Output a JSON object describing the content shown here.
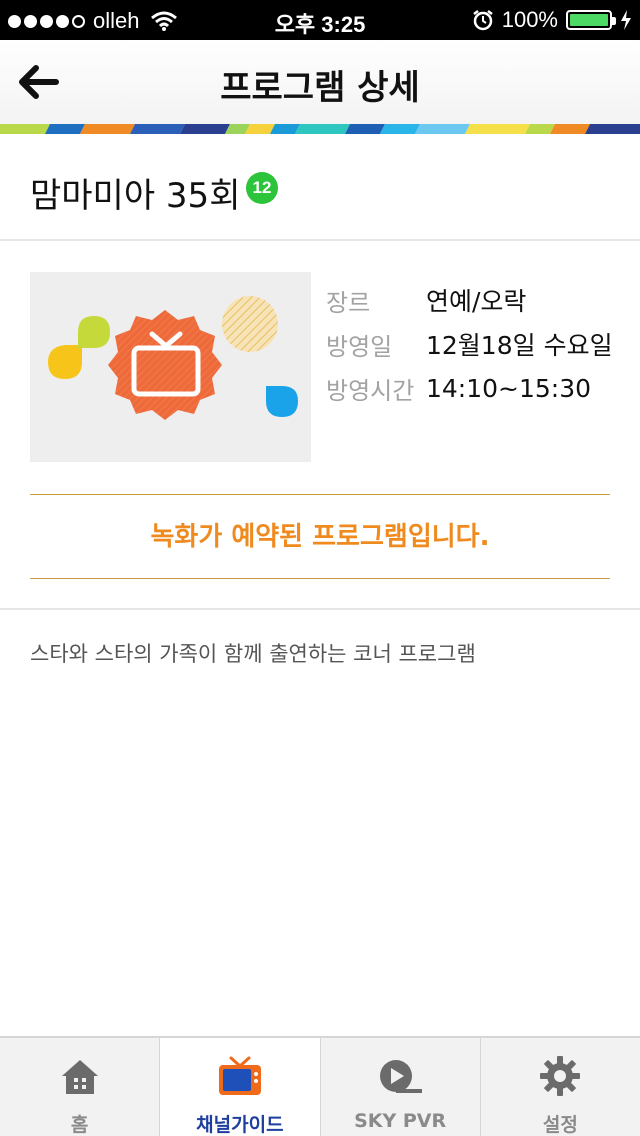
{
  "status_bar": {
    "carrier": "olleh",
    "time": "오후 3:25",
    "battery_text": "100%",
    "battery_color": "#4cd964"
  },
  "nav": {
    "title": "프로그램 상세",
    "back_icon": "arrow-left-icon"
  },
  "program": {
    "title": "맘마미아 35회",
    "age_rating": "12",
    "age_badge_color": "#2cc43a"
  },
  "info": {
    "genre_label": "장르",
    "genre_value": "연예/오락",
    "airdate_label": "방영일",
    "airdate_value": "12월18일 수요일",
    "airtime_label": "방영시간",
    "airtime_value": "14:10~15:30"
  },
  "notice": {
    "text": "녹화가 예약된 프로그램입니다.",
    "color": "#ef8a1e"
  },
  "description": "스타와 스타의 가족이 함께 출연하는 코너 프로그램",
  "tabs": [
    {
      "label": "홈",
      "icon": "home-icon",
      "active": false
    },
    {
      "label": "채널가이드",
      "icon": "tv-icon",
      "active": true
    },
    {
      "label": "SKY PVR",
      "icon": "pvr-icon",
      "active": false
    },
    {
      "label": "설정",
      "icon": "gear-icon",
      "active": false
    }
  ]
}
